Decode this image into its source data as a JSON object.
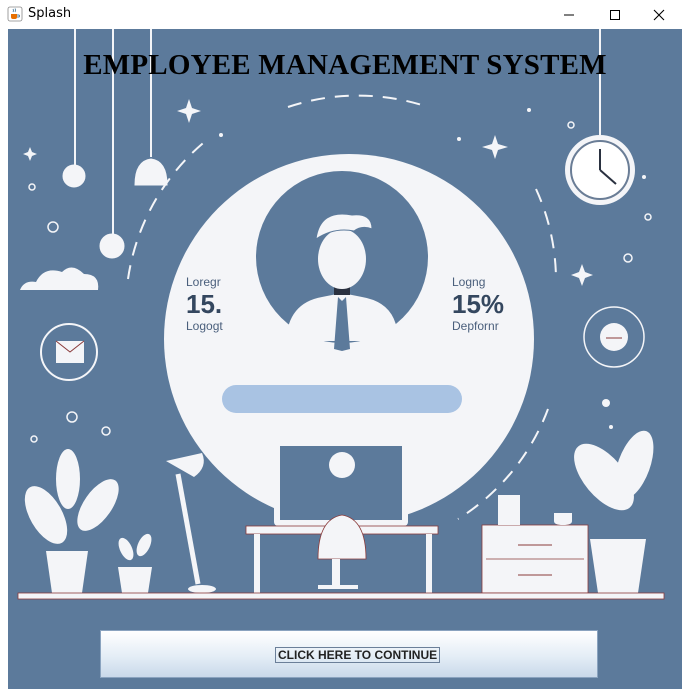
{
  "window": {
    "title": "Splash",
    "icons": [
      "java-cup-icon",
      "minimize-icon",
      "maximize-icon",
      "close-icon"
    ]
  },
  "splash": {
    "title": "EMPLOYEE MANAGEMENT SYSTEM",
    "stat_left": {
      "top": "Loregr",
      "value": "15.",
      "bottom": "Logogt"
    },
    "stat_right": {
      "top": "Logng",
      "value": "15%",
      "bottom": "Depfornr"
    },
    "progress_fraction": 1.0
  },
  "continue_button": {
    "label": "CLICK HERE TO CONTINUE"
  },
  "colors": {
    "background": "#5c7a9b",
    "circle": "#f4f5f8",
    "progress": "#a9c3e3",
    "title": "#000000"
  }
}
